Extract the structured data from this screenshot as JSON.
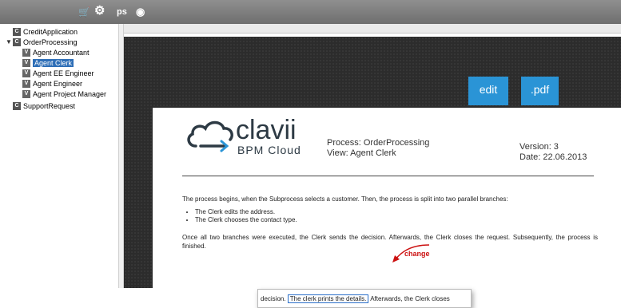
{
  "toolbar": {
    "icons": [
      "cart-icon",
      "gear-icon",
      "eye-icon"
    ],
    "ps_label": "ps"
  },
  "tree": [
    {
      "type": "C",
      "label": "CreditApplication"
    },
    {
      "type": "C",
      "label": "OrderProcessing",
      "expanded": true
    },
    {
      "type": "V",
      "label": "Agent Accountant"
    },
    {
      "type": "V",
      "label": "Agent Clerk",
      "selected": true
    },
    {
      "type": "V",
      "label": "Agent EE Engineer"
    },
    {
      "type": "V",
      "label": "Agent Engineer"
    },
    {
      "type": "V",
      "label": "Agent Project Manager"
    },
    {
      "type": "C",
      "label": "SupportRequest"
    }
  ],
  "buttons": {
    "edit": "edit",
    "pdf": ".pdf"
  },
  "document": {
    "logo_word": "clavii",
    "logo_sub": "BPM Cloud",
    "process": "Process: OrderProcessing",
    "view": "View: Agent Clerk",
    "version": "Version: 3",
    "date": "Date: 22.06.2013",
    "para1": "The process begins, when the Subprocess selects a customer. Then, the process is split into two parallel branches:",
    "bullets": [
      "The Clerk edits the address.",
      "The Clerk chooses the contact type."
    ],
    "para2": "Once all two branches were executed, the Clerk sends the decision. Afterwards, the Clerk closes the request. Subsequently, the process is finished.",
    "change_label": "change"
  },
  "zoom": {
    "before": "decision. ",
    "highlight": "The clerk prints the details.",
    "after": " Afterwards, the Clerk closes"
  },
  "colors": {
    "accent": "#2a94d6",
    "selection": "#2f6fb7",
    "change": "#cc1111"
  }
}
